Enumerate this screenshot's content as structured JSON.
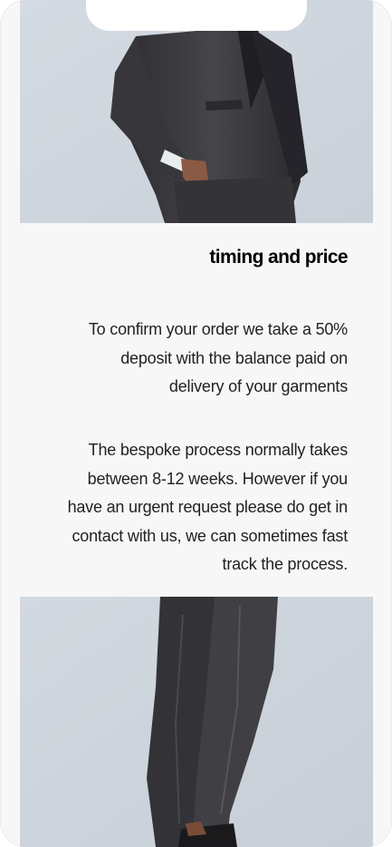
{
  "section": {
    "heading": "timing and price",
    "paragraphs": [
      {
        "lines": [
          "To confirm your order we take a 50%",
          "deposit with the balance paid on",
          "delivery of your garments"
        ]
      },
      {
        "lines": [
          "The bespoke process normally takes",
          "between 8-12 weeks. However if you",
          "have an urgent request please do get in",
          "contact with us, we can sometimes fast",
          "track the process."
        ]
      }
    ]
  },
  "images": {
    "top": {
      "subject": "suit-jacket-photo"
    },
    "bottom": {
      "subject": "suit-trousers-photo"
    }
  },
  "colors": {
    "page_background": "#f7f7f7",
    "photo_background": "#cfd6de",
    "suit_fabric": "#3a3a3e",
    "heading_text": "#000000",
    "body_text": "#222222"
  }
}
